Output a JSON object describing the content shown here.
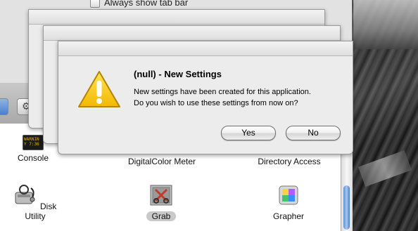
{
  "prefs": {
    "checkbox_label": "Always show tab bar"
  },
  "apps": [
    {
      "label": "Console"
    },
    {
      "label": "DigitalColor Meter"
    },
    {
      "label": "Directory Access"
    },
    {
      "label": "Disk Utility"
    },
    {
      "label": "Grab"
    },
    {
      "label": "Grapher"
    }
  ],
  "console_icon_text": "WARNIN\nY 7:36",
  "dialog": {
    "title": "(null) - New Settings",
    "line1": "New settings have been created for this application.",
    "line2": "Do you wish to use these settings from now on?",
    "yes_label": "Yes",
    "no_label": "No"
  },
  "colors": {
    "warning_yellow": "#f5c400",
    "selection_pill": "#c9c9c9"
  },
  "icons": {
    "alert": "warning-triangle-icon",
    "console": "console-icon",
    "disk_utility": "disk-utility-icon",
    "grab": "grab-icon",
    "grapher": "grapher-icon"
  }
}
